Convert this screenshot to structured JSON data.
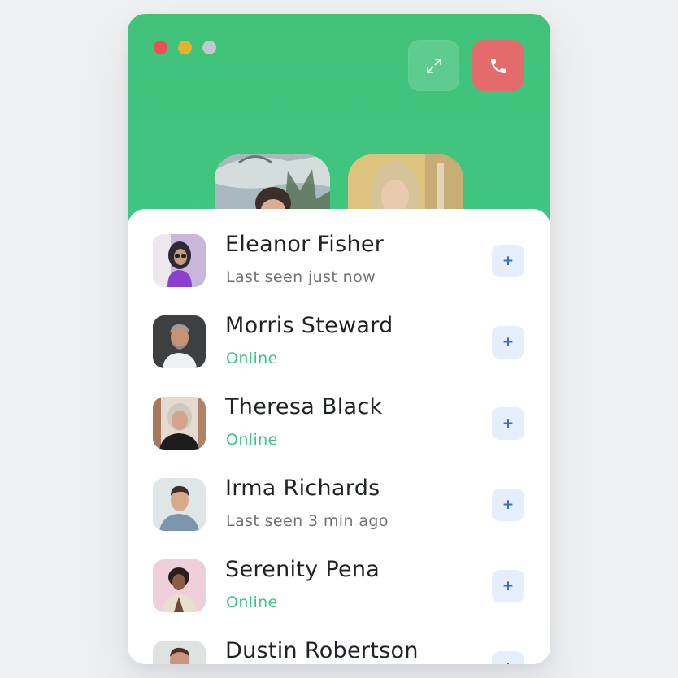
{
  "window_controls": [
    "close",
    "minimize",
    "zoom"
  ],
  "header": {
    "expand_icon": "expand-arrows-icon",
    "end_call_icon": "phone-icon",
    "colors": {
      "header_green": "#41c27a",
      "end_call_red": "#e36b6c",
      "online_green": "#3cc383",
      "add_button_bg": "#e6edfb",
      "add_button_fg": "#2d6ee0"
    }
  },
  "participants": [
    {
      "role": "video-participant-1"
    },
    {
      "role": "video-participant-2"
    }
  ],
  "contacts": [
    {
      "name": "Eleanor Fisher",
      "status": "Last seen just now",
      "online": false,
      "add_label": "+"
    },
    {
      "name": "Morris Steward",
      "status": "Online",
      "online": true,
      "add_label": "+"
    },
    {
      "name": "Theresa Black",
      "status": "Online",
      "online": true,
      "add_label": "+"
    },
    {
      "name": "Irma Richards",
      "status": "Last seen 3 min ago",
      "online": false,
      "add_label": "+"
    },
    {
      "name": "Serenity Pena",
      "status": "Online",
      "online": true,
      "add_label": "+"
    },
    {
      "name": "Dustin Robertson",
      "status": "",
      "online": false,
      "add_label": "+"
    }
  ]
}
